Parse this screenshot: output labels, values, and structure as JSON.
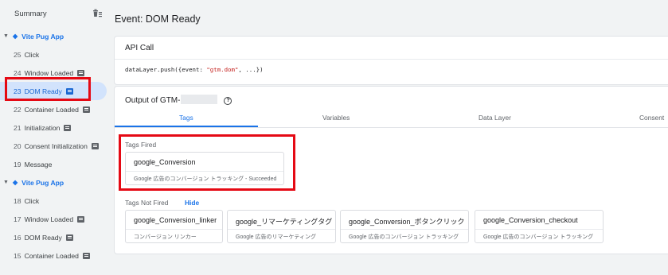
{
  "sidebar": {
    "title": "Summary",
    "groups": [
      {
        "label": "Vite Pug App",
        "items": [
          {
            "num": "25",
            "label": "Click",
            "badge": false
          },
          {
            "num": "24",
            "label": "Window Loaded",
            "badge": true
          },
          {
            "num": "23",
            "label": "DOM Ready",
            "badge": true,
            "selected": true
          },
          {
            "num": "22",
            "label": "Container Loaded",
            "badge": true
          },
          {
            "num": "21",
            "label": "Initialization",
            "badge": true
          },
          {
            "num": "20",
            "label": "Consent Initialization",
            "badge": true
          },
          {
            "num": "19",
            "label": "Message",
            "badge": false
          }
        ]
      },
      {
        "label": "Vite Pug App",
        "items": [
          {
            "num": "18",
            "label": "Click",
            "badge": false
          },
          {
            "num": "17",
            "label": "Window Loaded",
            "badge": true
          },
          {
            "num": "16",
            "label": "DOM Ready",
            "badge": true
          },
          {
            "num": "15",
            "label": "Container Loaded",
            "badge": true
          }
        ]
      }
    ]
  },
  "main": {
    "title": "Event: DOM Ready",
    "api": {
      "title": "API Call",
      "code_prefix": "dataLayer.push({event: ",
      "code_string": "\"gtm.dom\"",
      "code_suffix": ", ...})"
    },
    "output": {
      "title": "Output of GTM-",
      "tabs": [
        "Tags",
        "Variables",
        "Data Layer",
        "Consent"
      ],
      "active_tab": "Tags",
      "fired_label": "Tags Fired",
      "fired": [
        {
          "name": "google_Conversion",
          "desc": "Google 広告のコンバージョン トラッキング - Succeeded"
        }
      ],
      "not_fired_label": "Tags Not Fired",
      "hide_label": "Hide",
      "not_fired": [
        {
          "name": "google_Conversion_linker",
          "desc": "コンバージョン リンカー"
        },
        {
          "name": "google_リマーケティングタグ",
          "desc": "Google 広告のリマーケティング"
        },
        {
          "name": "google_Conversion_ボタンクリック",
          "desc": "Google 広告のコンバージョン トラッキング"
        },
        {
          "name": "google_Conversion_checkout",
          "desc": "Google 広告のコンバージョン トラッキング"
        }
      ]
    }
  },
  "colors": {
    "accent": "#1a73e8",
    "selected_bg": "#d2e3fc",
    "highlight_red": "#e50914"
  }
}
